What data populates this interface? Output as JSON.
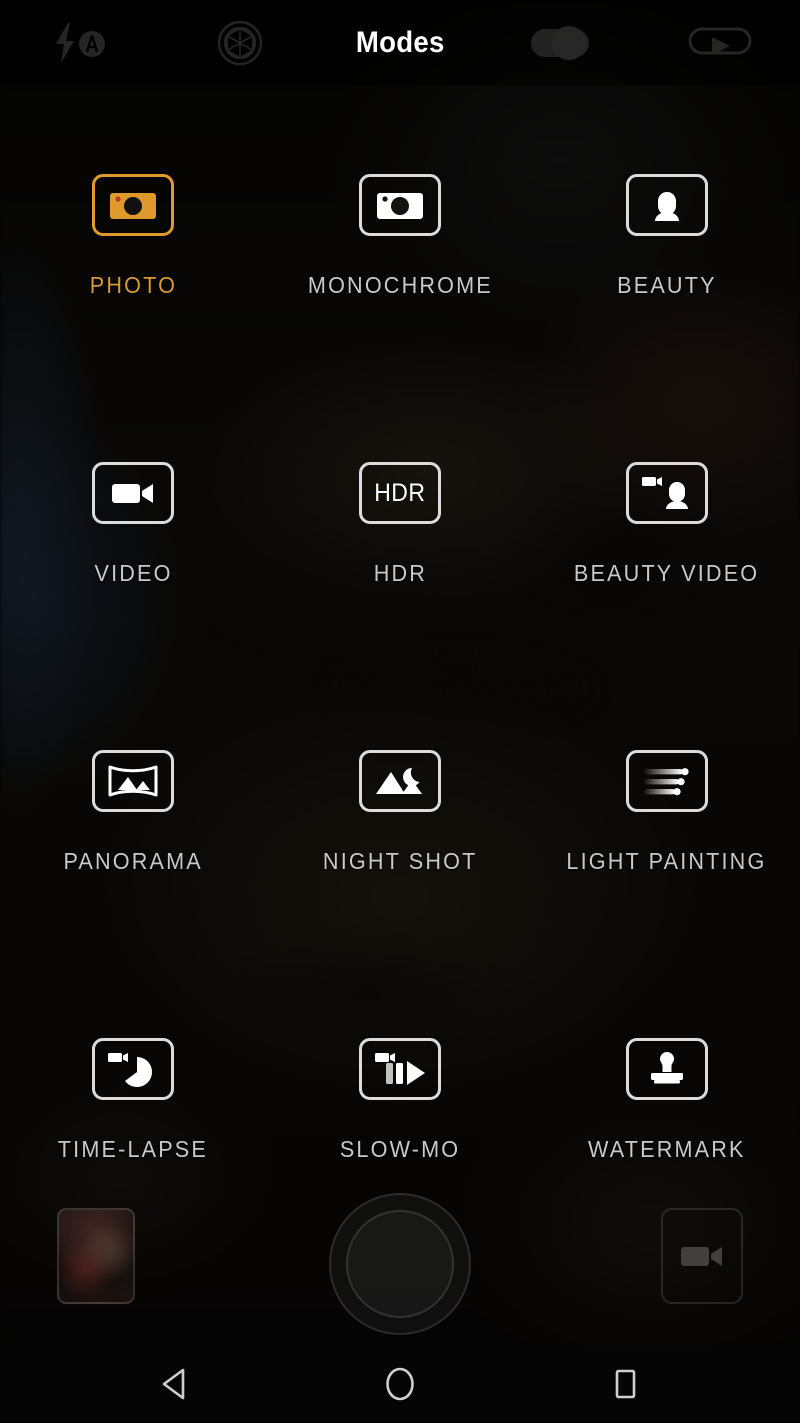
{
  "app": {
    "title": "Modes",
    "accent_color": "#D89A33",
    "label_color": "#C9C9C9"
  },
  "topbar": {
    "title": "Modes",
    "left_icons": [
      {
        "name": "flash-auto-icon",
        "label": "Flash auto"
      },
      {
        "name": "aperture-icon",
        "label": "Aperture"
      }
    ],
    "right_icons": [
      {
        "name": "wide-aperture-toggle-icon",
        "label": "Wide aperture"
      },
      {
        "name": "switch-camera-icon",
        "label": "Switch camera"
      }
    ]
  },
  "modes": [
    {
      "label": "PHOTO",
      "icon": "camera-icon",
      "selected": true
    },
    {
      "label": "MONOCHROME",
      "icon": "camera-icon",
      "selected": false
    },
    {
      "label": "BEAUTY",
      "icon": "portrait-icon",
      "selected": false
    },
    {
      "label": "VIDEO",
      "icon": "camcorder-icon",
      "selected": false
    },
    {
      "label": "HDR",
      "icon": "hdr-text-icon",
      "selected": false,
      "icon_text": "HDR"
    },
    {
      "label": "BEAUTY VIDEO",
      "icon": "beauty-video-icon",
      "selected": false
    },
    {
      "label": "PANORAMA",
      "icon": "panorama-icon",
      "selected": false
    },
    {
      "label": "NIGHT SHOT",
      "icon": "night-shot-icon",
      "selected": false
    },
    {
      "label": "LIGHT PAINTING",
      "icon": "light-painting-icon",
      "selected": false
    },
    {
      "label": "TIME-LAPSE",
      "icon": "time-lapse-icon",
      "selected": false
    },
    {
      "label": "SLOW-MO",
      "icon": "slow-mo-icon",
      "selected": false
    },
    {
      "label": "WATERMARK",
      "icon": "watermark-icon",
      "selected": false
    }
  ],
  "bottombar": {
    "gallery_thumbnail": "gallery-thumbnail",
    "shutter_button": "shutter-button",
    "record_button": "video-record-button",
    "page_dots": 3,
    "active_dot_index": 0
  },
  "navbar": {
    "back": "back-button",
    "home": "home-button",
    "recents": "recents-button"
  }
}
